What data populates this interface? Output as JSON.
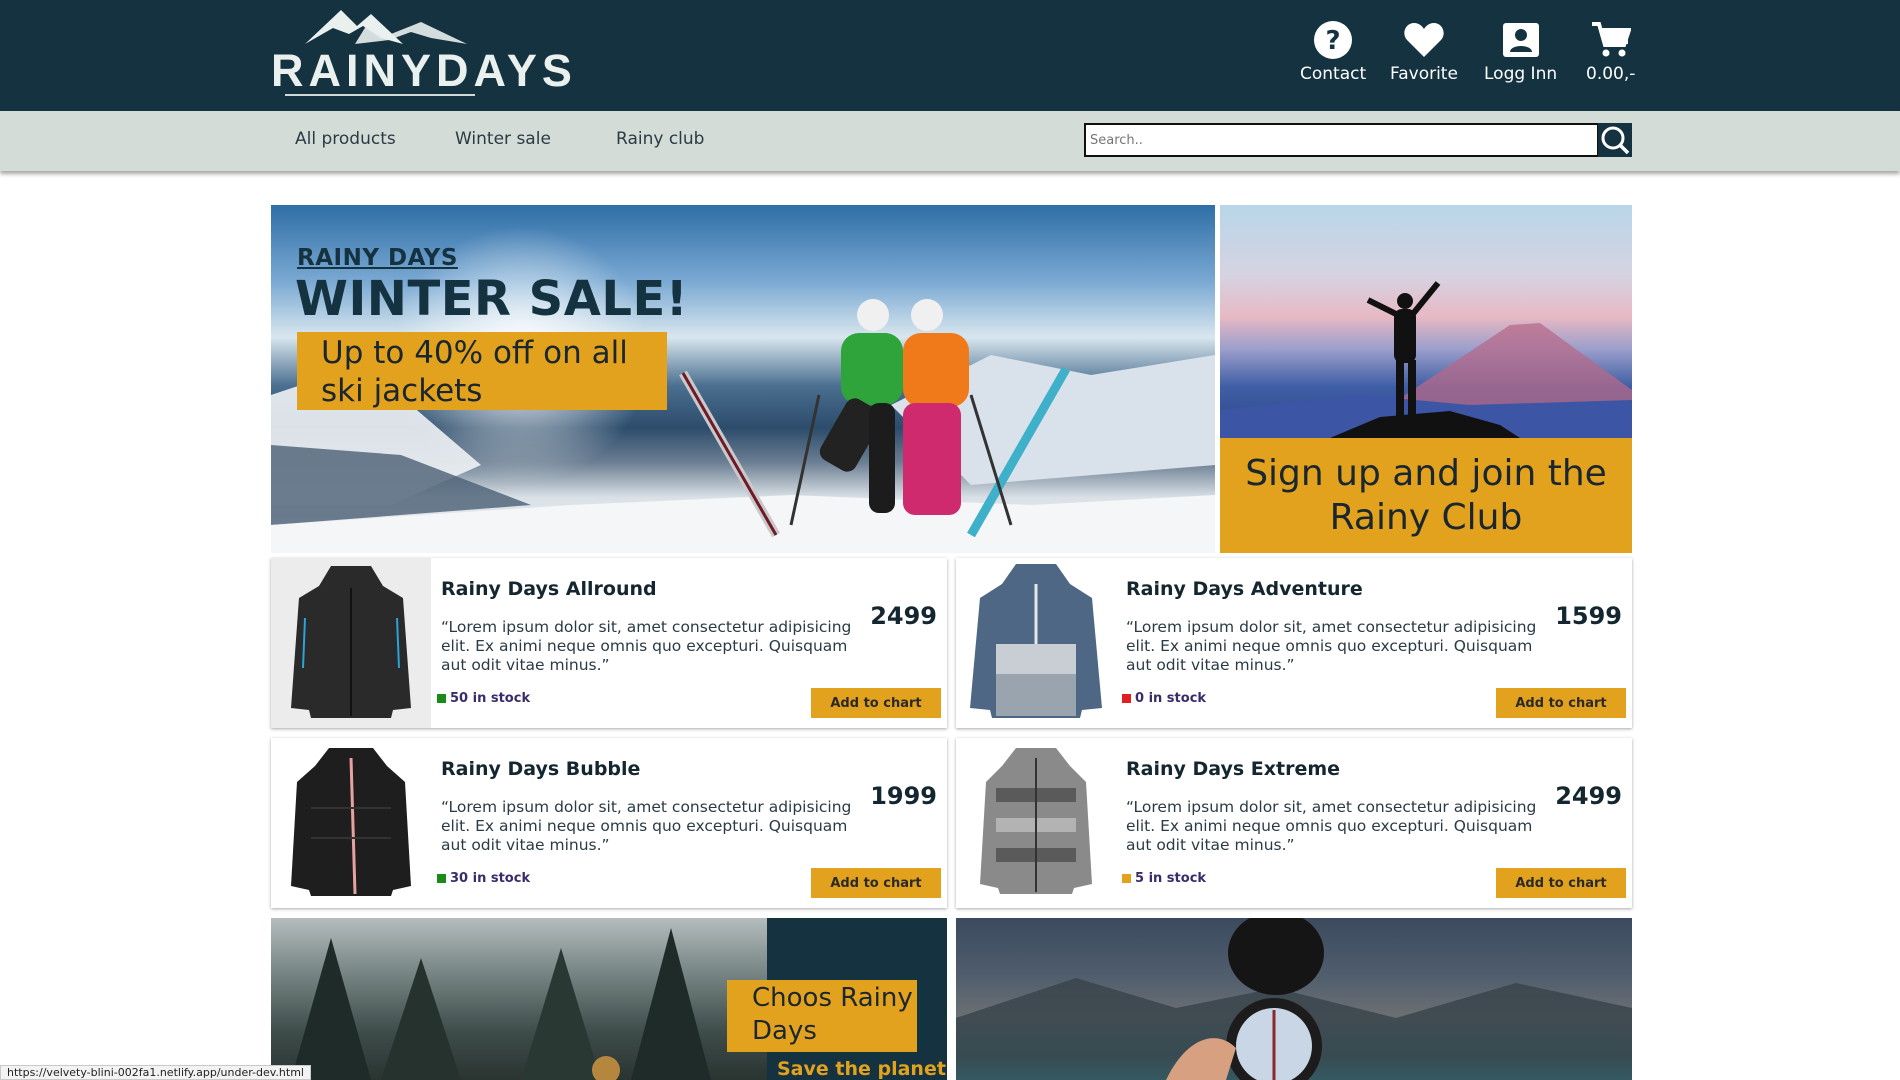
{
  "brand": {
    "name": "RAINYDAYS"
  },
  "header": {
    "nav": [
      {
        "label": "Contact",
        "icon": "help-icon"
      },
      {
        "label": "Favorite",
        "icon": "heart-icon"
      },
      {
        "label": "Logg Inn",
        "icon": "user-icon"
      },
      {
        "label": "0.00,-",
        "icon": "cart-icon"
      }
    ]
  },
  "navbar": {
    "links": [
      "All products",
      "Winter sale",
      "Rainy club"
    ],
    "search_placeholder": "Search.."
  },
  "hero": {
    "kicker": "RAINY DAYS",
    "title": "WINTER SALE!",
    "offer": "Up to 40% off on all ski jackets"
  },
  "club": {
    "text": "Sign up and join the Rainy Club"
  },
  "products": [
    {
      "name": "Rainy Days Allround",
      "description": "“Lorem ipsum dolor sit, amet consectetur adipisicing elit. Ex animi neque omnis quo excepturi. Quisquam aut odit vitae minus.”",
      "price": "2499",
      "stock": "50 in stock",
      "stock_color": "#1a8a1a",
      "button": "Add to chart"
    },
    {
      "name": "Rainy Days Adventure",
      "description": "“Lorem ipsum dolor sit, amet consectetur adipisicing elit. Ex animi neque omnis quo excepturi. Quisquam aut odit vitae minus.”",
      "price": "1599",
      "stock": "0 in stock",
      "stock_color": "#e02020",
      "button": "Add to chart"
    },
    {
      "name": "Rainy Days Bubble",
      "description": "“Lorem ipsum dolor sit, amet consectetur adipisicing elit. Ex animi neque omnis quo excepturi. Quisquam aut odit vitae minus.”",
      "price": "1999",
      "stock": "30 in stock",
      "stock_color": "#1a8a1a",
      "button": "Add to chart"
    },
    {
      "name": "Rainy Days Extreme",
      "description": "“Lorem ipsum dolor sit, amet consectetur adipisicing elit. Ex animi neque omnis quo excepturi. Quisquam aut odit vitae minus.”",
      "price": "2499",
      "stock": "5 in stock",
      "stock_color": "#e3a21d",
      "button": "Add to chart"
    }
  ],
  "promo": {
    "choose": "Choos Rainy Days",
    "save": "Save the planet"
  },
  "status_url": "https://velvety-blini-002fa1.netlify.app/under-dev.html",
  "colors": {
    "primary": "#143240",
    "accent": "#e3a21d",
    "navbar": "#d3dcd6"
  }
}
